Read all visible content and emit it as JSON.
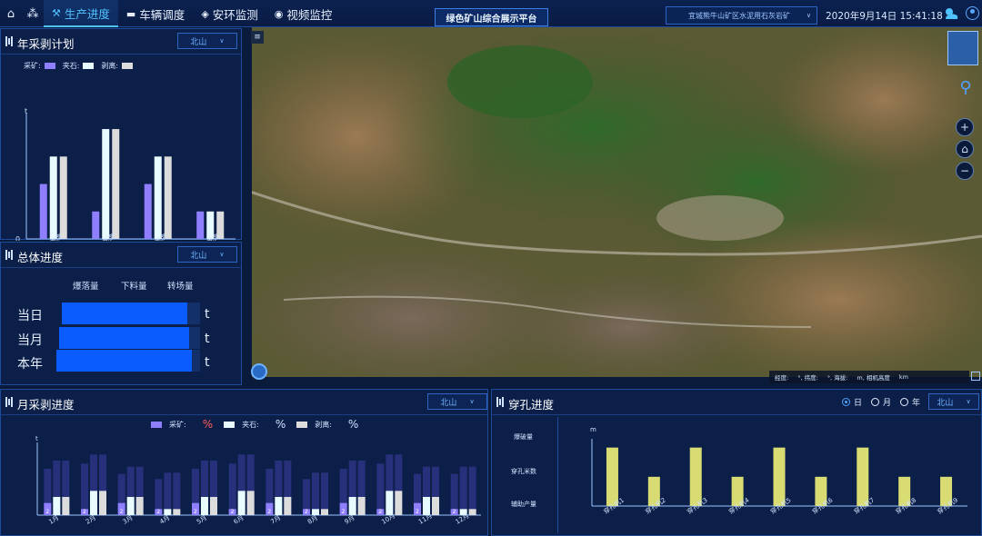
{
  "nav": {
    "tabs": [
      {
        "icon": "tools-icon",
        "label": "生产进度",
        "active": true
      },
      {
        "icon": "truck-icon",
        "label": "车辆调度",
        "active": false
      },
      {
        "icon": "shield-icon",
        "label": "安环监测",
        "active": false
      },
      {
        "icon": "camera-icon",
        "label": "视频监控",
        "active": false
      }
    ]
  },
  "header": {
    "platform_title": "绿色矿山综合展示平台",
    "mine_select": "宜城熊牛山矿区水泥用石灰岩矿",
    "datetime": "2020年9月14日 15:41:18"
  },
  "annual_plan": {
    "title": "年采剥计划",
    "select": "北山",
    "legend": [
      "采矿:",
      "夹石:",
      "剥离:"
    ],
    "colors": {
      "mining": "#8f7fff",
      "interlayer": "#e8fbff",
      "stripping": "#dcdcdc"
    },
    "y_unit": "t",
    "y_zero": "0"
  },
  "overall_progress": {
    "title": "总体进度",
    "select": "北山",
    "columns": [
      "爆落量",
      "下料量",
      "转场量"
    ],
    "rows": [
      {
        "label": "当日",
        "unit": "t",
        "progress": 0.91
      },
      {
        "label": "当月",
        "unit": "t",
        "progress": 0.92
      },
      {
        "label": "本年",
        "unit": "t",
        "progress": 0.94
      }
    ]
  },
  "monthly_progress": {
    "title": "月采剥进度",
    "select": "北山",
    "legend": [
      {
        "label": "采矿:",
        "pct": "%",
        "color": "#8f7fff"
      },
      {
        "label": "夹石:",
        "pct": "%",
        "color": "#e8fbff"
      },
      {
        "label": "剥离:",
        "pct": "%",
        "color": "#dcdcdc"
      }
    ],
    "y_unit": "t",
    "bar_label": "2"
  },
  "drilling_progress": {
    "title": "穿孔进度",
    "select": "北山",
    "period_options": [
      {
        "label": "日",
        "selected": true
      },
      {
        "label": "月",
        "selected": false
      },
      {
        "label": "年",
        "selected": false
      }
    ],
    "row_labels": [
      "爆破量",
      "穿孔米数",
      "辅助产量"
    ],
    "y_unit": "m"
  },
  "map": {
    "status_fields": [
      "经度:",
      "°, 纬度:",
      "°, 海拔:",
      "m, 相机高度",
      "km"
    ]
  },
  "chart_data": [
    {
      "type": "bar",
      "title": "年采剥计划",
      "categories": [
        "一季度",
        "二季度",
        "三季度",
        "四季度"
      ],
      "series": [
        {
          "name": "采矿",
          "values": [
            2,
            1,
            2,
            1
          ]
        },
        {
          "name": "夹石",
          "values": [
            3,
            4,
            3,
            1
          ]
        },
        {
          "name": "剥离",
          "values": [
            3,
            4,
            3,
            1
          ]
        }
      ],
      "ylabel": "t",
      "ylim": [
        0,
        4.3
      ],
      "legend": "top-left"
    },
    {
      "type": "bar",
      "title": "月采剥进度",
      "categories": [
        "1月",
        "2月",
        "3月",
        "4月",
        "5月",
        "6月",
        "7月",
        "8月",
        "9月",
        "10月",
        "11月",
        "12月"
      ],
      "series": [
        {
          "name": "采矿",
          "values": [
            2,
            1,
            2,
            1,
            2,
            1,
            2,
            1,
            2,
            1,
            2,
            1
          ]
        },
        {
          "name": "夹石",
          "values": [
            3,
            4,
            3,
            1,
            3,
            4,
            3,
            1,
            3,
            4,
            3,
            1
          ]
        },
        {
          "name": "剥离",
          "values": [
            3,
            4,
            3,
            1,
            3,
            4,
            3,
            1,
            3,
            4,
            3,
            1
          ]
        }
      ],
      "background_values": [
        9,
        10,
        8,
        7,
        9,
        10,
        9,
        7,
        9,
        10,
        8,
        8
      ],
      "ylabel": "t",
      "ylim": [
        0,
        12
      ]
    },
    {
      "type": "bar",
      "title": "穿孔进度",
      "categories": [
        "穿孔机1",
        "穿孔机2",
        "穿孔机3",
        "穿孔机4",
        "穿孔机5",
        "穿孔机6",
        "穿孔机7",
        "穿孔机8",
        "穿孔机9"
      ],
      "values": [
        2,
        1,
        2,
        1,
        2,
        1,
        2,
        1,
        1
      ],
      "ylabel": "m",
      "ylim": [
        0,
        2.3
      ]
    }
  ]
}
